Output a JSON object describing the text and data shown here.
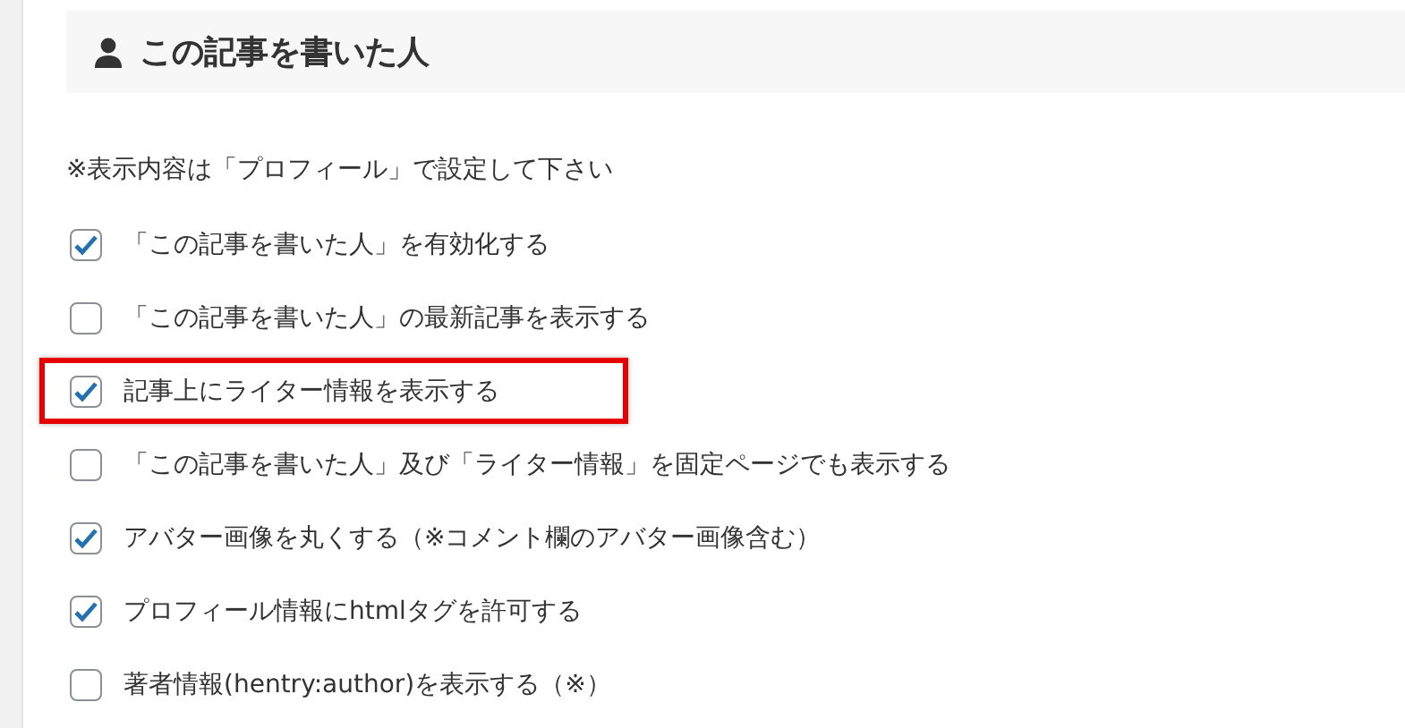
{
  "section": {
    "title": "この記事を書いた人"
  },
  "note": "※表示内容は「プロフィール」で設定して下さい",
  "options": [
    {
      "label": "「この記事を書いた人」を有効化する",
      "checked": true,
      "highlighted": false
    },
    {
      "label": "「この記事を書いた人」の最新記事を表示する",
      "checked": false,
      "highlighted": false
    },
    {
      "label": "記事上にライター情報を表示する",
      "checked": true,
      "highlighted": true
    },
    {
      "label": "「この記事を書いた人」及び「ライター情報」を固定ページでも表示する",
      "checked": false,
      "highlighted": false
    },
    {
      "label": "アバター画像を丸くする（※コメント欄のアバター画像含む）",
      "checked": true,
      "highlighted": false
    },
    {
      "label": "プロフィール情報にhtmlタグを許可する",
      "checked": true,
      "highlighted": false
    },
    {
      "label": "著者情報(hentry:author)を表示する（※）",
      "checked": false,
      "highlighted": false
    }
  ]
}
